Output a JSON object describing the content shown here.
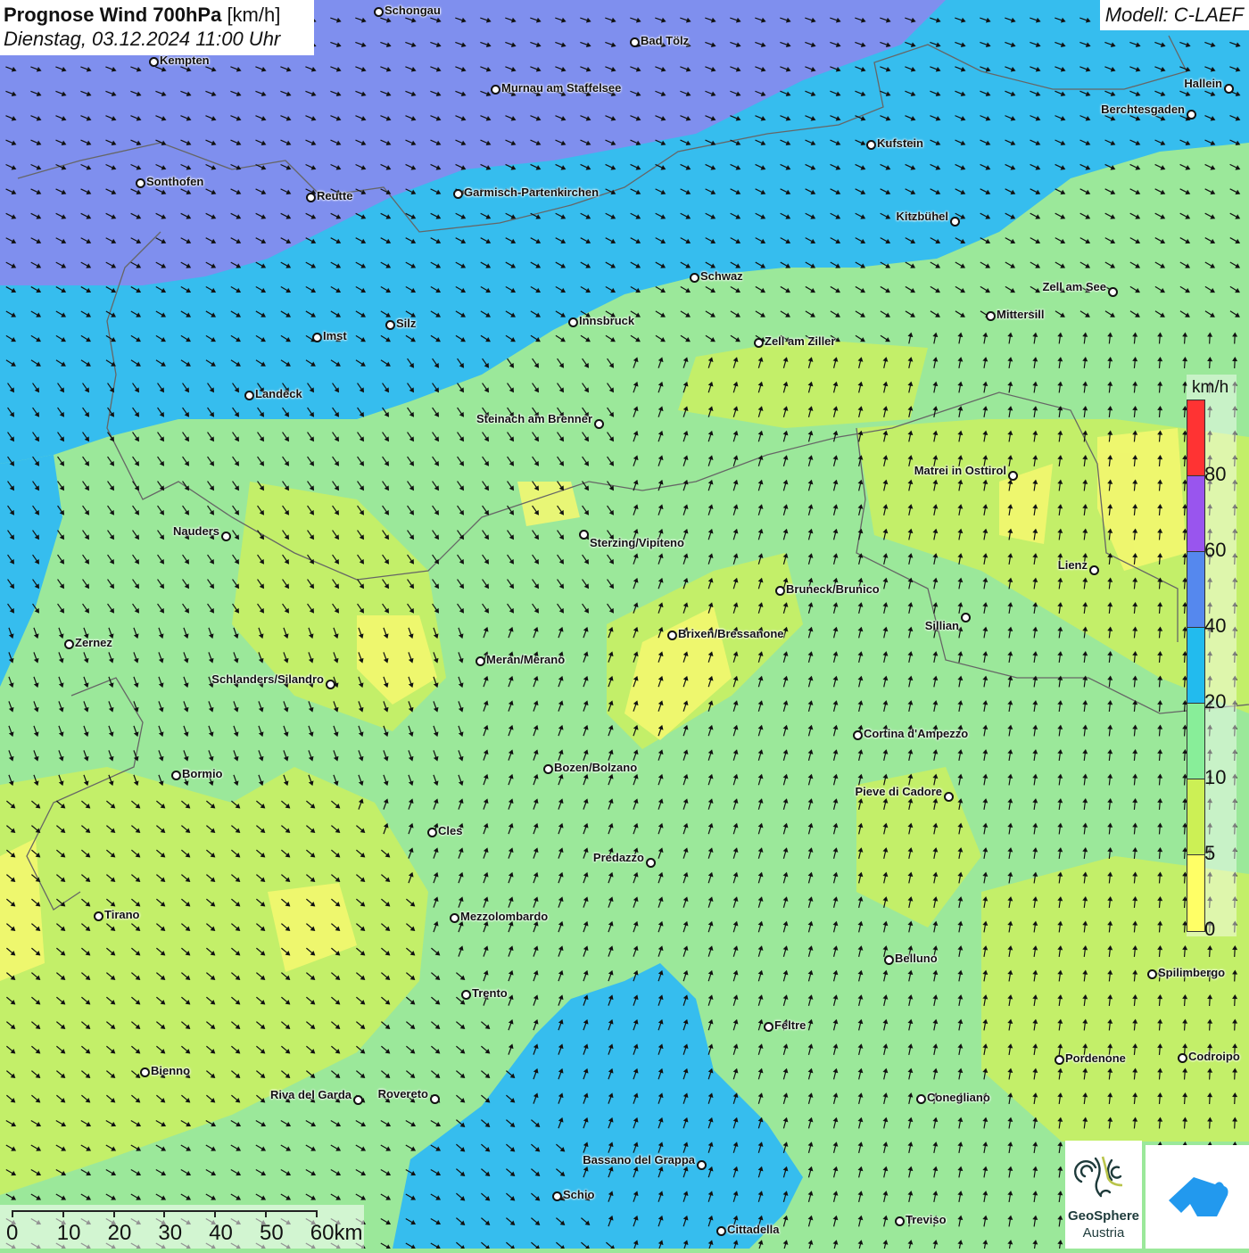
{
  "header": {
    "title_bold": "Prognose Wind 700hPa",
    "title_unit": "[km/h]",
    "datetime": "Dienstag, 03.12.2024 11:00 Uhr",
    "model": "Modell: C-LAEF"
  },
  "legend": {
    "unit": "km/h",
    "colors": [
      "#ff3333",
      "#9955ee",
      "#5588ee",
      "#22bbee",
      "#88ee99",
      "#ccf055",
      "#ffff66"
    ],
    "ticks": [
      "80",
      "60",
      "40",
      "20",
      "10",
      "5",
      "0"
    ]
  },
  "scale_bar": {
    "labels": [
      "0",
      "10",
      "20",
      "30",
      "40",
      "50",
      "60km"
    ]
  },
  "logos": {
    "geosphere_line1": "GeoSphere",
    "geosphere_line2": "Austria"
  },
  "cities": [
    "Schongau",
    "Bad Tölz",
    "Kempten",
    "Murnau am Staffelsee",
    "Hallein",
    "Berchtesgaden",
    "Kufstein",
    "Sonthofen",
    "Reutte",
    "Garmisch-Partenkirchen",
    "Kitzbühel",
    "Schwaz",
    "Zell am See",
    "Mittersill",
    "Innsbruck",
    "Silz",
    "Imst",
    "Zell am Ziller",
    "Landeck",
    "Steinach am Brenner",
    "Matrei in Osttirol",
    "Nauders",
    "Sterzing/Vipiteno",
    "Lienz",
    "Bruneck/Brunico",
    "Sillian",
    "Brixen/Bressanone",
    "Zernez",
    "Meran/Merano",
    "Schlanders/Silandro",
    "Cortina d'Ampezzo",
    "Bozen/Bolzano",
    "Bormio",
    "Pieve di Cadore",
    "Cles",
    "Predazzo",
    "Tirano",
    "Mezzolombardo",
    "Belluno",
    "Spilimbergo",
    "Trento",
    "Feltre",
    "Pordenone",
    "Codroipo",
    "Bienno",
    "Riva del Garda",
    "Rovereto",
    "Conegliano",
    "Bassano del Grappa",
    "Schio",
    "Treviso",
    "Cittadella"
  ],
  "colors": {
    "wind_0_5": "#ffff66",
    "wind_5_10": "#ccf055",
    "wind_10_20": "#88ee99",
    "wind_20_40": "#33bbee",
    "wind_40_60": "#7f8fee"
  }
}
